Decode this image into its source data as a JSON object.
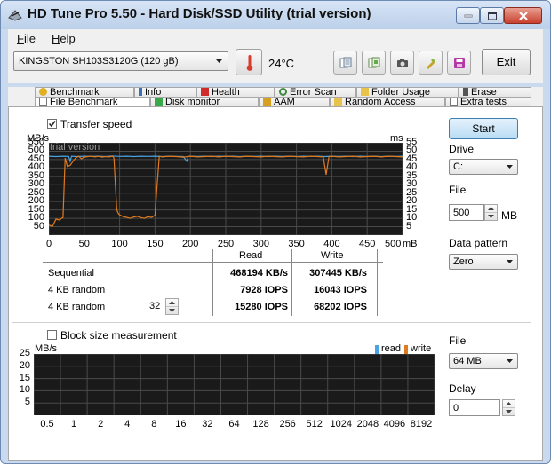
{
  "window": {
    "title": "HD Tune Pro 5.50 - Hard Disk/SSD Utility (trial version)"
  },
  "menu": [
    {
      "label": "File",
      "underline": "F",
      "rest": "ile"
    },
    {
      "label": "Help",
      "underline": "H",
      "rest": "elp"
    }
  ],
  "toolbar": {
    "drive": "KINGSTON SH103S3120G (120 gB)",
    "temperature": "24°C",
    "exit_label": "Exit",
    "icons": [
      "copy-text-icon",
      "copy-screen-icon",
      "screenshot-icon",
      "options-icon",
      "save-icon"
    ]
  },
  "tabs": {
    "row1": [
      "Benchmark",
      "Info",
      "Health",
      "Error Scan",
      "Folder Usage",
      "Erase"
    ],
    "row2": [
      "File Benchmark",
      "Disk monitor",
      "AAM",
      "Random Access",
      "Extra tests"
    ],
    "active": "File Benchmark"
  },
  "transfer": {
    "checkbox_label": "Transfer speed",
    "checked": true,
    "watermark": "trial version",
    "left_unit": "MB/s",
    "right_unit": "ms"
  },
  "chart_data": [
    {
      "type": "line",
      "title": "",
      "xlabel": "mB",
      "ylabel": "MB/s",
      "y2label": "ms",
      "x_ticks": [
        0,
        50,
        100,
        150,
        200,
        250,
        300,
        350,
        400,
        450,
        500
      ],
      "y_ticks": [
        50,
        100,
        150,
        200,
        250,
        300,
        350,
        400,
        450,
        500,
        550
      ],
      "y2_ticks": [
        5,
        10,
        15,
        20,
        25,
        30,
        35,
        40,
        45,
        50,
        55
      ],
      "xlim": [
        0,
        500
      ],
      "ylim": [
        0,
        550
      ],
      "grid": true,
      "series": [
        {
          "color": "#4ba3e3",
          "x": [
            0,
            10,
            20,
            28,
            30,
            32,
            40,
            50,
            60,
            70,
            80,
            90,
            100,
            110,
            120,
            130,
            140,
            150,
            160,
            170,
            180,
            190,
            195,
            197,
            199,
            210,
            220,
            230,
            240,
            250,
            260,
            270,
            280,
            290,
            300,
            310,
            320,
            330,
            340,
            350,
            360,
            370,
            380,
            390,
            400,
            410,
            420,
            430,
            440,
            450,
            460,
            470,
            480,
            490,
            500
          ],
          "y": [
            470,
            468,
            470,
            469,
            440,
            470,
            468,
            470,
            469,
            470,
            468,
            471,
            469,
            470,
            468,
            470,
            469,
            470,
            468,
            470,
            469,
            468,
            440,
            468,
            470,
            469,
            470,
            468,
            470,
            469,
            470,
            468,
            470,
            469,
            470,
            468,
            470,
            469,
            470,
            468,
            470,
            469,
            470,
            468,
            470,
            469,
            470,
            468,
            470,
            469,
            470,
            468,
            470,
            469,
            470
          ]
        },
        {
          "color": "#e07a1e",
          "x": [
            0,
            5,
            10,
            15,
            18,
            20,
            23,
            26,
            30,
            34,
            38,
            42,
            46,
            50,
            55,
            60,
            65,
            70,
            75,
            80,
            85,
            90,
            92,
            94,
            96,
            98,
            100,
            105,
            110,
            115,
            120,
            125,
            130,
            135,
            140,
            145,
            150,
            153,
            156,
            160,
            170,
            180,
            190,
            200,
            210,
            220,
            230,
            240,
            250,
            260,
            270,
            280,
            290,
            300,
            310,
            320,
            330,
            340,
            350,
            360,
            370,
            380,
            388,
            392,
            396,
            400,
            410,
            420,
            430,
            440,
            450,
            460,
            470,
            480,
            490,
            500
          ],
          "y": [
            60,
            52,
            95,
            90,
            100,
            105,
            460,
            410,
            415,
            440,
            460,
            470,
            455,
            465,
            468,
            470,
            466,
            470,
            465,
            468,
            466,
            470,
            460,
            300,
            150,
            130,
            120,
            110,
            105,
            100,
            108,
            112,
            104,
            100,
            110,
            105,
            118,
            300,
            470,
            466,
            470,
            468,
            465,
            470,
            466,
            468,
            470,
            466,
            470,
            468,
            466,
            470,
            468,
            466,
            470,
            468,
            466,
            470,
            468,
            466,
            470,
            468,
            466,
            360,
            468,
            470,
            466,
            468,
            470,
            466,
            468,
            470,
            466,
            470,
            468,
            466
          ]
        }
      ]
    },
    {
      "type": "bar",
      "title": "",
      "ylabel": "MB/s",
      "categories": [
        "0.5",
        "1",
        "2",
        "4",
        "8",
        "16",
        "32",
        "64",
        "128",
        "256",
        "512",
        "1024",
        "2048",
        "4096",
        "8192"
      ],
      "y_ticks": [
        5,
        10,
        15,
        20,
        25
      ],
      "ylim": [
        0,
        25
      ],
      "grid": true,
      "legend": [
        {
          "name": "read",
          "color": "#4ba3e3"
        },
        {
          "name": "write",
          "color": "#e07a1e"
        }
      ],
      "series": []
    }
  ],
  "results": {
    "header_read": "Read",
    "header_write": "Write",
    "rows": [
      {
        "label": "Sequential",
        "read": "468194 KB/s",
        "write": "307445 KB/s"
      },
      {
        "label": "4 KB random",
        "read": "7928 IOPS",
        "write": "16043 IOPS"
      },
      {
        "label": "4 KB random",
        "read": "15280 IOPS",
        "write": "68202 IOPS"
      }
    ],
    "queue_depth": "32"
  },
  "block": {
    "checkbox_label": "Block size measurement",
    "checked": false,
    "unit": "MB/s"
  },
  "side": {
    "start_label": "Start",
    "drive_label": "Drive",
    "drive_value": "C:",
    "file_label": "File",
    "file_size": "500",
    "file_unit": "MB",
    "pattern_label": "Data pattern",
    "pattern_value": "Zero",
    "file2_label": "File",
    "file2_value": "64 MB",
    "delay_label": "Delay",
    "delay_value": "0"
  },
  "colors": {
    "read": "#4ba3e3",
    "write": "#e07a1e",
    "chart_bg": "#1a1a1a",
    "grid": "#4a4a4a"
  }
}
